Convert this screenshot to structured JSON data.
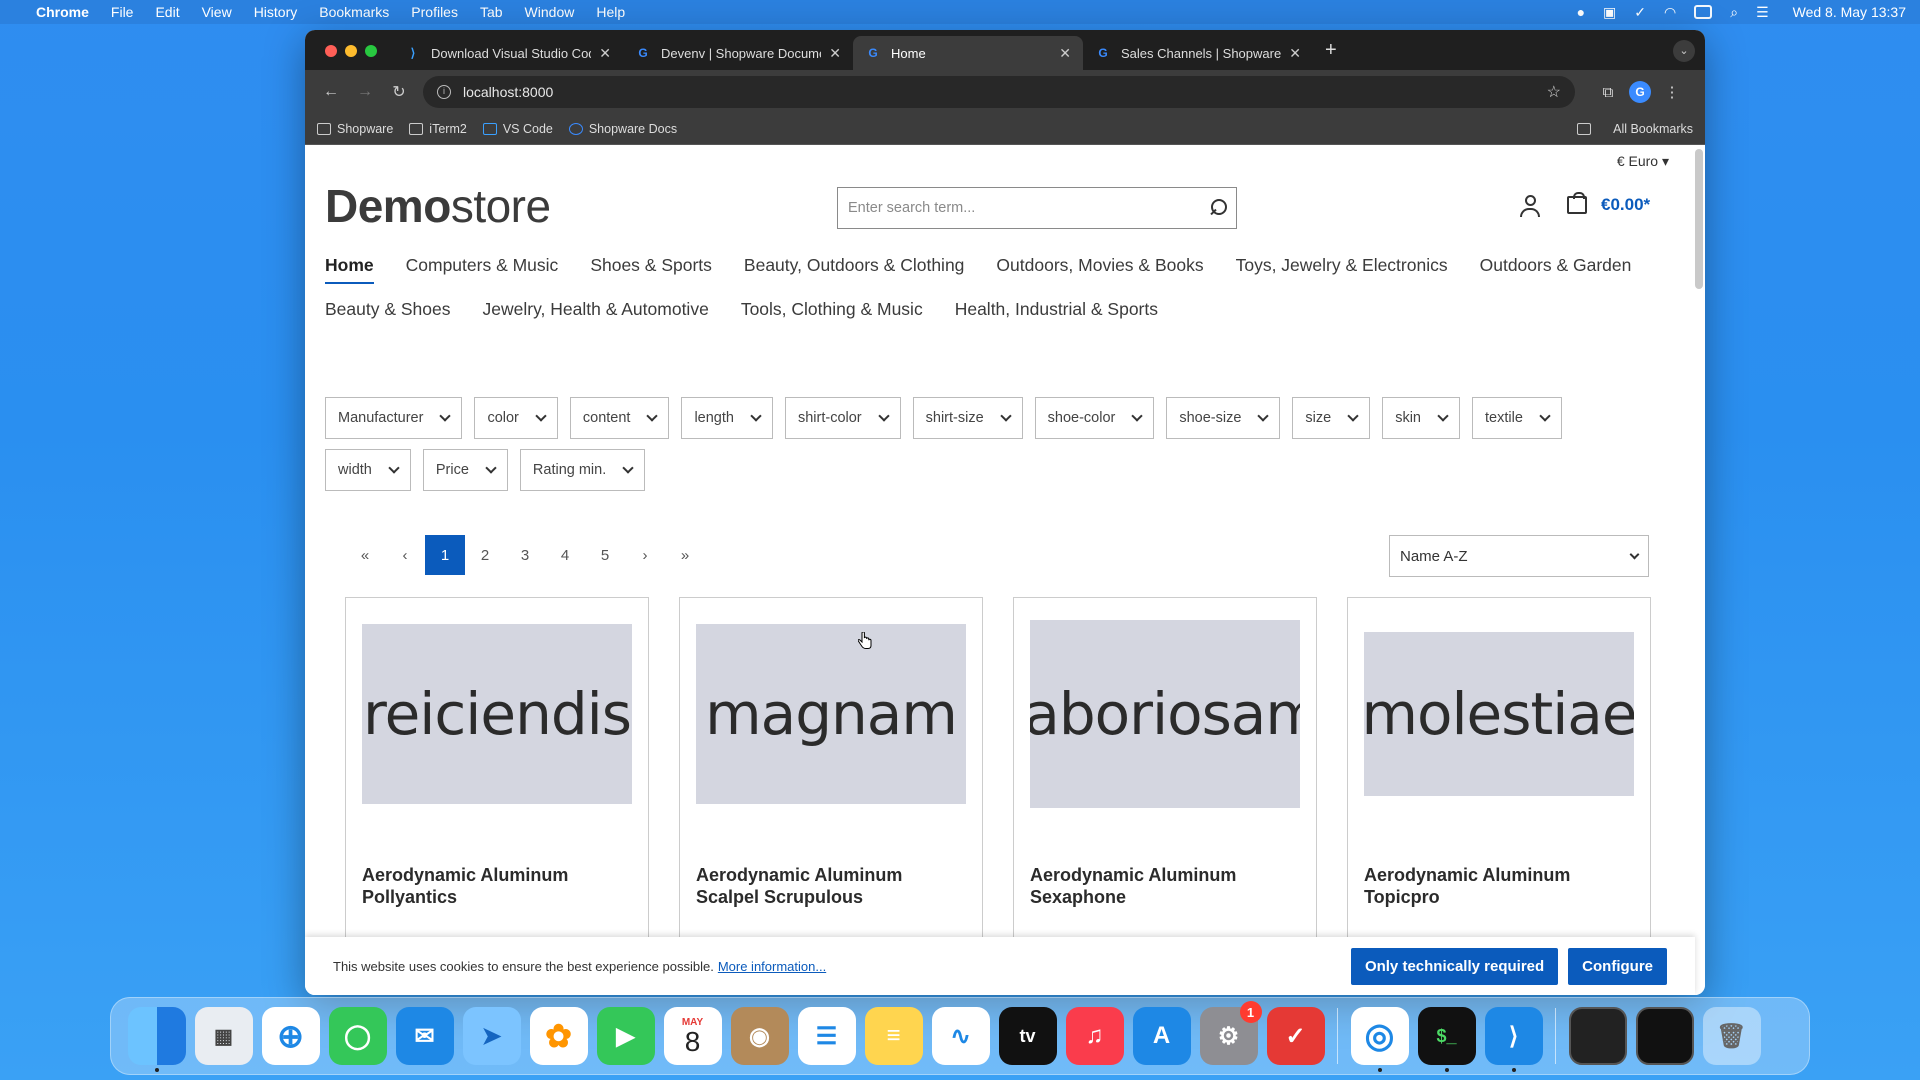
{
  "menubar": {
    "app": "Chrome",
    "items": [
      "File",
      "Edit",
      "View",
      "History",
      "Bookmarks",
      "Profiles",
      "Tab",
      "Window",
      "Help"
    ],
    "clock": "Wed 8. May  13:37"
  },
  "browser": {
    "tabs": [
      {
        "title": "Download Visual Studio Code",
        "icon": "vscode-icon"
      },
      {
        "title": "Devenv | Shopware Documen",
        "icon": "shopware-icon"
      },
      {
        "title": "Home",
        "icon": "shopware-icon"
      },
      {
        "title": "Sales Channels | Shopware A",
        "icon": "shopware-icon"
      }
    ],
    "url": "localhost:8000",
    "bookmarks": [
      "Shopware",
      "iTerm2",
      "VS Code",
      "Shopware Docs"
    ],
    "all_bookmarks": "All Bookmarks"
  },
  "store": {
    "currency": "€ Euro",
    "logo_bold": "Demo",
    "logo_light": "store",
    "search_placeholder": "Enter search term...",
    "cart_total": "€0.00*",
    "nav_row1": [
      "Home",
      "Computers & Music",
      "Shoes & Sports",
      "Beauty, Outdoors & Clothing",
      "Outdoors, Movies & Books",
      "Toys, Jewelry & Electronics",
      "Outdoors & Garden"
    ],
    "nav_row2": [
      "Beauty & Shoes",
      "Jewelry, Health & Automotive",
      "Tools, Clothing & Music",
      "Health, Industrial & Sports"
    ],
    "filters_row1": [
      "Manufacturer",
      "color",
      "content",
      "length",
      "shirt-color",
      "shirt-size",
      "shoe-color",
      "shoe-size",
      "size",
      "skin",
      "textile"
    ],
    "filters_row2": [
      "width",
      "Price",
      "Rating min."
    ],
    "pagination": [
      "«",
      "‹",
      "1",
      "2",
      "3",
      "4",
      "5",
      "›",
      "»"
    ],
    "current_page": "1",
    "sort": "Name A-Z",
    "products": [
      {
        "image_text": "reiciendis",
        "name": "Aerodynamic Aluminum Pollyantics"
      },
      {
        "image_text": "magnam",
        "name": "Aerodynamic Aluminum Scalpel Scrupulous"
      },
      {
        "image_text": "laboriosam",
        "name": "Aerodynamic Aluminum Sexaphone"
      },
      {
        "image_text": "molestiae",
        "name": "Aerodynamic Aluminum Topicpro"
      }
    ],
    "cookie": {
      "text": "This website uses cookies to ensure the best experience possible.",
      "link": "More information...",
      "btn_required": "Only technically required",
      "btn_configure": "Configure"
    }
  },
  "dock": {
    "calendar_month": "MAY",
    "calendar_day": "8",
    "settings_badge": "1",
    "apps": [
      "finder-icon",
      "launchpad-icon",
      "safari-icon",
      "messages-icon",
      "mail-icon",
      "maps-icon",
      "photos-icon",
      "facetime-icon",
      "calendar-icon",
      "contacts-icon",
      "reminders-icon",
      "notes-icon",
      "freeform-icon",
      "appletv-icon",
      "music-icon",
      "appstore-icon",
      "settings-icon",
      "tasks-icon",
      "chrome-icon",
      "terminal-icon",
      "vscode-icon",
      "window-thumbnail-icon",
      "window-thumbnail-icon",
      "trash-icon"
    ]
  },
  "colors": {
    "accent": "#0b5bbc",
    "desktop": "#2f8df0",
    "chrome_dark": "#3c3c3c"
  }
}
